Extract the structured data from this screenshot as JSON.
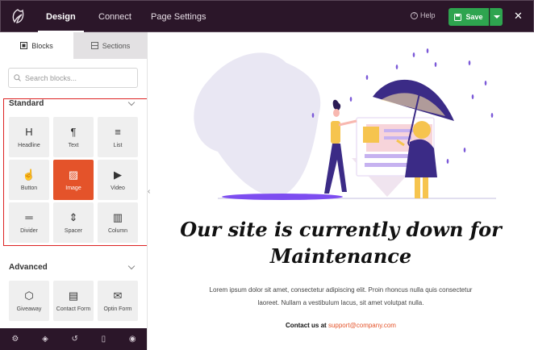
{
  "topbar": {
    "tabs": [
      {
        "label": "Design",
        "active": true
      },
      {
        "label": "Connect",
        "active": false
      },
      {
        "label": "Page Settings",
        "active": false
      }
    ],
    "help_label": "Help",
    "save_label": "Save",
    "brand_color": "#2b1629",
    "save_color": "#2ea44f"
  },
  "sidebar": {
    "tabs": [
      {
        "label": "Blocks",
        "icon": "blocks-icon",
        "active": true
      },
      {
        "label": "Sections",
        "icon": "sections-icon",
        "active": false
      }
    ],
    "search_placeholder": "Search blocks...",
    "standard": {
      "title": "Standard",
      "blocks": [
        {
          "label": "Headline",
          "icon": "H"
        },
        {
          "label": "Text",
          "icon": "¶"
        },
        {
          "label": "List",
          "icon": "≡"
        },
        {
          "label": "Button",
          "icon": "☝"
        },
        {
          "label": "Image",
          "icon": "▨",
          "active": true
        },
        {
          "label": "Video",
          "icon": "▶"
        },
        {
          "label": "Divider",
          "icon": "═"
        },
        {
          "label": "Spacer",
          "icon": "⇕"
        },
        {
          "label": "Column",
          "icon": "▥"
        }
      ]
    },
    "advanced": {
      "title": "Advanced",
      "blocks": [
        {
          "label": "Giveaway",
          "icon": "⬡"
        },
        {
          "label": "Contact Form",
          "icon": "▤"
        },
        {
          "label": "Optin Form",
          "icon": "✉"
        }
      ]
    },
    "accent_color": "#e4532a"
  },
  "page": {
    "headline_line1": "Our site is currently down for",
    "headline_line2": "Maintenance",
    "paragraph_line1": "Lorem ipsum dolor sit amet, consectetur adipiscing elit. Proin rhoncus nulla quis consectetur",
    "paragraph_line2": "laoreet. Nullam a vestibulum lacus, sit amet volutpat nulla.",
    "contact_label": "Contact us at",
    "contact_email": "support@company.com"
  }
}
